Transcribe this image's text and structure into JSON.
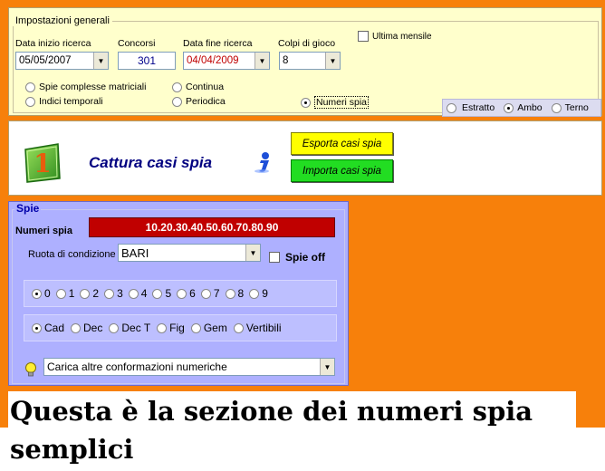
{
  "settings": {
    "legend": "Impostazioni generali",
    "start_date": {
      "label": "Data inizio ricerca",
      "value": "05/05/2007"
    },
    "concorsi": {
      "label": "Concorsi",
      "value": "301"
    },
    "end_date": {
      "label": "Data fine ricerca",
      "value": "04/04/2009"
    },
    "colpi": {
      "label": "Colpi di gioco",
      "value": "8"
    },
    "ultima_mensile": "Ultima mensile",
    "radios": {
      "spie_complesse": "Spie complesse matriciali",
      "indici_temporali": "Indici temporali",
      "continua": "Continua",
      "periodica": "Periodica",
      "numeri_spia": "Numeri spia"
    },
    "game_type": {
      "estratto": "Estratto",
      "ambo": "Ambo",
      "terno": "Terno"
    }
  },
  "capture": {
    "logo_digit": "1",
    "title": "Cattura casi spia",
    "export_label": "Esporta casi spia",
    "import_label": "Importa casi spia"
  },
  "spie": {
    "legend": "Spie",
    "numeri_label": "Numeri spia",
    "numeri_value": "10.20.30.40.50.60.70.80.90",
    "ruota_label": "Ruota di condizione",
    "ruota_value": "BARI",
    "spie_off": "Spie off",
    "digits": [
      "0",
      "1",
      "2",
      "3",
      "4",
      "5",
      "6",
      "7",
      "8",
      "9"
    ],
    "forms": [
      "Cad",
      "Dec",
      "Dec T",
      "Fig",
      "Gem",
      "Vertibili"
    ],
    "carica": "Carica altre conformazioni numeriche"
  },
  "caption": "Questa è la sezione dei numeri spia semplici",
  "colors": {
    "background": "#F7800B",
    "settings_bg": "#FFFFCC",
    "spie_bg": "#AEB0FF",
    "numeri_bg": "#C00000",
    "export_btn": "#FFFF00",
    "import_btn": "#22DD22",
    "title": "#000080"
  },
  "icons": {
    "logo": "green-square-one-icon",
    "info": "info-icon",
    "bulb": "lightbulb-icon"
  }
}
